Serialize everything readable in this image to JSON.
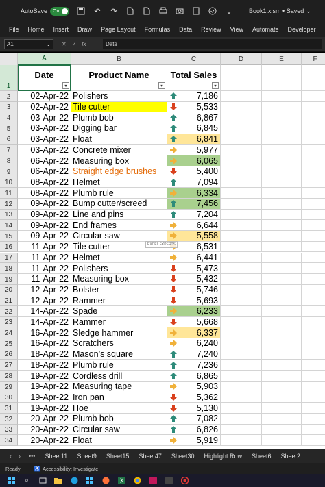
{
  "titlebar": {
    "autosave_label": "AutoSave",
    "autosave_state": "On",
    "filename": "Book1.xlsm • Saved"
  },
  "ribbon": {
    "tabs": [
      "File",
      "Home",
      "Insert",
      "Draw",
      "Page Layout",
      "Formulas",
      "Data",
      "Review",
      "View",
      "Automate",
      "Developer",
      "H"
    ]
  },
  "formula_bar": {
    "name_box": "A1",
    "fx_label": "fx",
    "content": "Date"
  },
  "columns": [
    "A",
    "B",
    "C",
    "D",
    "E",
    "F"
  ],
  "table": {
    "headers": [
      "Date",
      "Product Name",
      "Total Sales"
    ],
    "rows": [
      {
        "row": "2",
        "date": "02-Apr-22",
        "product": "Polishers",
        "sales": "7,186",
        "arrow": "up",
        "style": ""
      },
      {
        "row": "3",
        "date": "02-Apr-22",
        "product": "Tile cutter",
        "sales": "5,533",
        "arrow": "down",
        "style": "yellow-product"
      },
      {
        "row": "4",
        "date": "03-Apr-22",
        "product": "Plumb bob",
        "sales": "6,867",
        "arrow": "up",
        "style": ""
      },
      {
        "row": "5",
        "date": "03-Apr-22",
        "product": "Digging bar",
        "sales": "6,845",
        "arrow": "up",
        "style": ""
      },
      {
        "row": "6",
        "date": "03-Apr-22",
        "product": "Float",
        "sales": "6,841",
        "arrow": "up",
        "style": "lightyellow-sales"
      },
      {
        "row": "7",
        "date": "03-Apr-22",
        "product": "Concrete mixer",
        "sales": "5,977",
        "arrow": "right",
        "style": ""
      },
      {
        "row": "8",
        "date": "06-Apr-22",
        "product": "Measuring box",
        "sales": "6,065",
        "arrow": "right",
        "style": "green-sales"
      },
      {
        "row": "9",
        "date": "06-Apr-22",
        "product": "Straight edge brushes",
        "sales": "5,400",
        "arrow": "down",
        "style": "orange-product"
      },
      {
        "row": "10",
        "date": "08-Apr-22",
        "product": "Helmet",
        "sales": "7,094",
        "arrow": "up",
        "style": ""
      },
      {
        "row": "11",
        "date": "08-Apr-22",
        "product": "Plumb rule",
        "sales": "6,334",
        "arrow": "right",
        "style": "green-sales"
      },
      {
        "row": "12",
        "date": "09-Apr-22",
        "product": "Bump cutter/screed",
        "sales": "7,456",
        "arrow": "up",
        "style": "green-sales"
      },
      {
        "row": "13",
        "date": "09-Apr-22",
        "product": "Line and pins",
        "sales": "7,204",
        "arrow": "up",
        "style": ""
      },
      {
        "row": "14",
        "date": "09-Apr-22",
        "product": "End frames",
        "sales": "6,644",
        "arrow": "right",
        "style": ""
      },
      {
        "row": "15",
        "date": "09-Apr-22",
        "product": "Circular saw",
        "sales": "5,558",
        "arrow": "right",
        "style": "lightyellow-sales"
      },
      {
        "row": "16",
        "date": "11-Apr-22",
        "product": "Tile cutter",
        "sales": "6,531",
        "arrow": "right",
        "style": ""
      },
      {
        "row": "17",
        "date": "11-Apr-22",
        "product": "Helmet",
        "sales": "6,441",
        "arrow": "right",
        "style": ""
      },
      {
        "row": "18",
        "date": "11-Apr-22",
        "product": "Polishers",
        "sales": "5,473",
        "arrow": "down",
        "style": ""
      },
      {
        "row": "19",
        "date": "11-Apr-22",
        "product": "Measuring box",
        "sales": "5,432",
        "arrow": "down",
        "style": ""
      },
      {
        "row": "20",
        "date": "12-Apr-22",
        "product": "Bolster",
        "sales": "5,746",
        "arrow": "down",
        "style": ""
      },
      {
        "row": "21",
        "date": "12-Apr-22",
        "product": "Rammer",
        "sales": "5,693",
        "arrow": "down",
        "style": ""
      },
      {
        "row": "22",
        "date": "14-Apr-22",
        "product": "Spade",
        "sales": "6,233",
        "arrow": "right",
        "style": "green-sales"
      },
      {
        "row": "23",
        "date": "14-Apr-22",
        "product": "Rammer",
        "sales": "5,668",
        "arrow": "down",
        "style": ""
      },
      {
        "row": "24",
        "date": "16-Apr-22",
        "product": "Sledge hammer",
        "sales": "6,337",
        "arrow": "right",
        "style": "lightyellow-sales"
      },
      {
        "row": "25",
        "date": "16-Apr-22",
        "product": "Scratchers",
        "sales": "6,240",
        "arrow": "right",
        "style": ""
      },
      {
        "row": "26",
        "date": "18-Apr-22",
        "product": "Mason’s square",
        "sales": "7,240",
        "arrow": "up",
        "style": ""
      },
      {
        "row": "27",
        "date": "18-Apr-22",
        "product": "Plumb rule",
        "sales": "7,236",
        "arrow": "up",
        "style": ""
      },
      {
        "row": "28",
        "date": "19-Apr-22",
        "product": "Cordless drill",
        "sales": "6,865",
        "arrow": "up",
        "style": ""
      },
      {
        "row": "29",
        "date": "19-Apr-22",
        "product": "Measuring tape",
        "sales": "5,903",
        "arrow": "right",
        "style": ""
      },
      {
        "row": "30",
        "date": "19-Apr-22",
        "product": "Iron pan",
        "sales": "5,362",
        "arrow": "down",
        "style": ""
      },
      {
        "row": "31",
        "date": "19-Apr-22",
        "product": "Hoe",
        "sales": "5,130",
        "arrow": "down",
        "style": ""
      },
      {
        "row": "32",
        "date": "20-Apr-22",
        "product": "Plumb bob",
        "sales": "7,082",
        "arrow": "up",
        "style": ""
      },
      {
        "row": "33",
        "date": "20-Apr-22",
        "product": "Circular saw",
        "sales": "6,826",
        "arrow": "up",
        "style": ""
      },
      {
        "row": "34",
        "date": "20-Apr-22",
        "product": "Float",
        "sales": "5,919",
        "arrow": "right",
        "style": ""
      }
    ]
  },
  "watermark": "EXCEL EXPERTS",
  "sheet_tabs": [
    "Sheet11",
    "Sheet9",
    "Sheet15",
    "Sheet47",
    "Sheet30",
    "Highlight Row",
    "Sheet6",
    "Sheet2"
  ],
  "status": {
    "ready": "Ready",
    "accessibility": "Accessibility: Investigate"
  },
  "colors": {
    "arrow_up": "#2e8b7a",
    "arrow_down": "#d9411e",
    "arrow_right": "#f0b13a",
    "highlight_yellow": "#ffff00",
    "highlight_green": "#a9d08e",
    "highlight_lightyellow": "#ffe699",
    "text_orange": "#e46c0a",
    "excel_green": "#217346"
  }
}
